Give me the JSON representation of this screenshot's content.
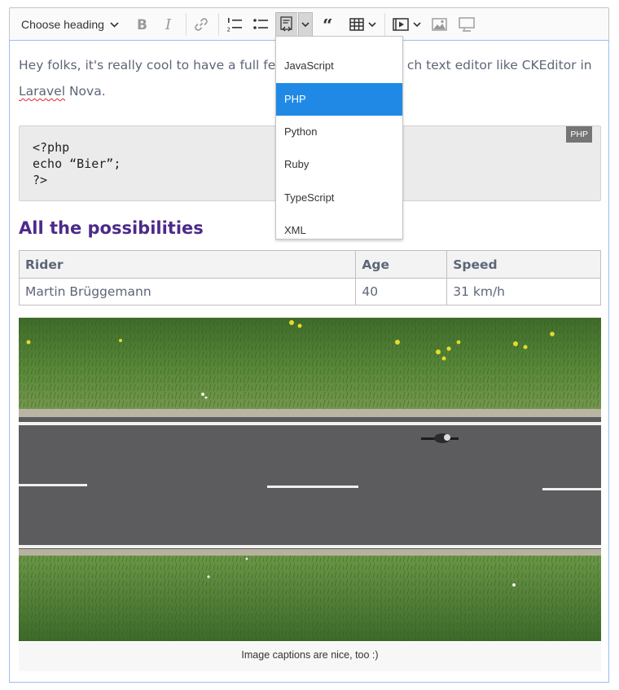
{
  "toolbar": {
    "heading_label": "Choose heading",
    "icons": [
      "bold-icon",
      "italic-icon",
      "link-icon",
      "numbered-list-icon",
      "bulleted-list-icon",
      "code-block-icon",
      "block-quote-icon",
      "table-icon",
      "media-embed-icon",
      "image-icon",
      "html-embed-icon"
    ]
  },
  "content": {
    "paragraph_before": "Hey folks, it's really cool to have a full feat",
    "paragraph_after": "ch text editor like CKEditor in",
    "paragraph_misspelled": "Laravel",
    "paragraph_end": " Nova.",
    "code": {
      "language_label": "PHP",
      "lines": [
        "<?php",
        "echo “Bier”;",
        "?>"
      ]
    },
    "heading": "All the possibilities",
    "table": {
      "headers": [
        "Rider",
        "Age",
        "Speed"
      ],
      "rows": [
        [
          "Martin Brüggemann",
          "40",
          "31 km/h"
        ]
      ]
    },
    "image_caption": "Image captions are nice, too :)"
  },
  "code_language_dropdown": {
    "items": [
      "JavaScript",
      "PHP",
      "Python",
      "Ruby",
      "TypeScript",
      "XML"
    ],
    "selected": "PHP"
  },
  "colors": {
    "accent": "#1f89e5",
    "heading": "#4c2a8a",
    "focus_border": "#9fbcf2"
  }
}
